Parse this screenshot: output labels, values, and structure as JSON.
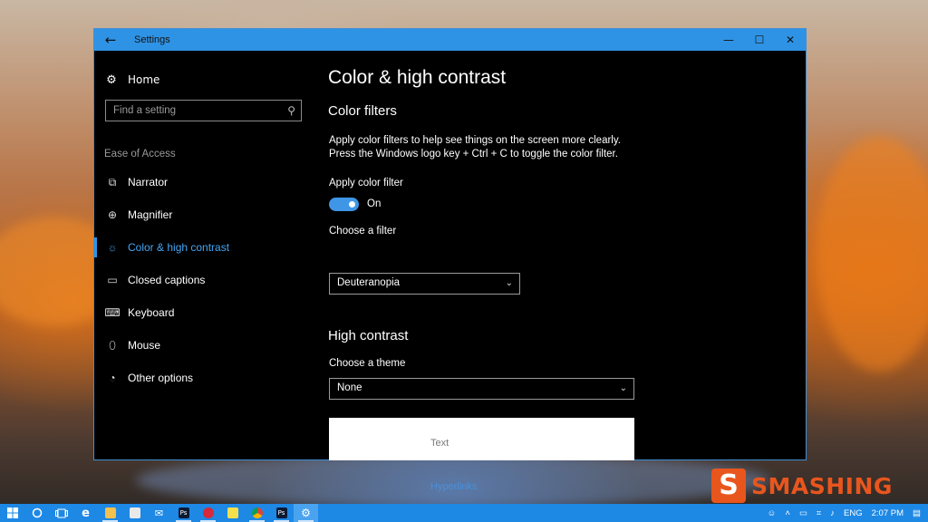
{
  "window": {
    "title": "Settings",
    "back_glyph": "←",
    "controls": [
      "—",
      "☐",
      "✕"
    ]
  },
  "sidebar": {
    "home_label": "Home",
    "search_placeholder": "Find a setting",
    "section_label": "Ease of Access",
    "items": [
      {
        "label": "Narrator",
        "icon": "narrator-icon"
      },
      {
        "label": "Magnifier",
        "icon": "magnifier-icon"
      },
      {
        "label": "Color & high contrast",
        "icon": "color-brightness-icon",
        "active": true
      },
      {
        "label": "Closed captions",
        "icon": "closed-captions-icon"
      },
      {
        "label": "Keyboard",
        "icon": "keyboard-icon"
      },
      {
        "label": "Mouse",
        "icon": "mouse-icon"
      },
      {
        "label": "Other options",
        "icon": "other-options-icon"
      }
    ]
  },
  "main": {
    "title": "Color & high contrast",
    "color_filters": {
      "heading": "Color filters",
      "description_line1": "Apply color filters to help see things on the screen more clearly.",
      "description_line2": "Press the Windows logo key + Ctrl + C to toggle the color filter.",
      "toggle_label": "Apply color filter",
      "toggle_state": "On",
      "filter_label": "Choose a filter",
      "filter_value": "Deuteranopia"
    },
    "high_contrast": {
      "heading": "High contrast",
      "theme_label": "Choose a theme",
      "theme_value": "None",
      "preview_text": "Text",
      "preview_link": "Hyperlinks"
    }
  },
  "watermark": {
    "logo_letter": "S",
    "text": "SMASHING"
  },
  "taskbar": {
    "apps": [
      {
        "icon": "windows-start-icon"
      },
      {
        "icon": "cortana-icon"
      },
      {
        "icon": "task-view-icon"
      },
      {
        "icon": "edge-icon"
      },
      {
        "icon": "file-explorer-icon"
      },
      {
        "icon": "store-icon"
      },
      {
        "icon": "mail-icon"
      },
      {
        "icon": "photoshop-icon",
        "text": "Ps"
      },
      {
        "icon": "app-red-icon"
      },
      {
        "icon": "sticky-notes-icon"
      },
      {
        "icon": "chrome-icon"
      },
      {
        "icon": "photoshop-icon",
        "text": "Ps"
      },
      {
        "icon": "settings-icon"
      }
    ],
    "language": "ENG",
    "time": "2:07 PM"
  },
  "colors": {
    "accent": "#2f93e5",
    "taskbar": "#1e88e5",
    "watermark": "#e8561e"
  }
}
